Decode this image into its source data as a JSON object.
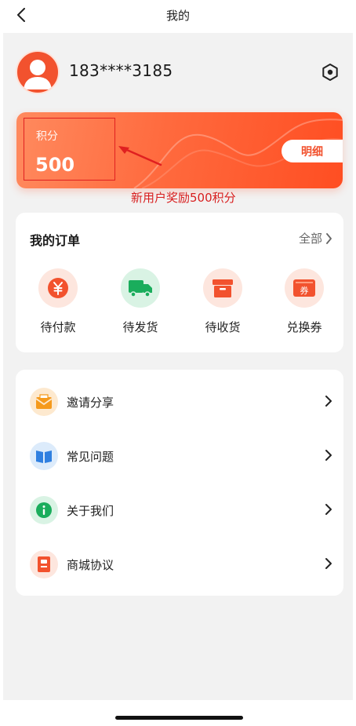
{
  "nav": {
    "title": "我的"
  },
  "profile": {
    "phone": "183****3185"
  },
  "points": {
    "label": "积分",
    "value": "500",
    "detail_label": "明细"
  },
  "annotation": {
    "text": "新用户奖励500积分",
    "color": "#d81e1e"
  },
  "orders": {
    "title": "我的订单",
    "all_label": "全部",
    "items": [
      {
        "label": "待付款",
        "icon": "yen-icon"
      },
      {
        "label": "待发货",
        "icon": "truck-icon"
      },
      {
        "label": "待收货",
        "icon": "box-icon"
      },
      {
        "label": "兑换券",
        "icon": "coupon-icon"
      }
    ]
  },
  "menu": {
    "items": [
      {
        "label": "邀请分享",
        "icon": "envelope-icon"
      },
      {
        "label": "常见问题",
        "icon": "book-icon"
      },
      {
        "label": "关于我们",
        "icon": "info-icon"
      },
      {
        "label": "商城协议",
        "icon": "document-icon"
      }
    ]
  },
  "colors": {
    "accent": "#f2522e",
    "card_gradient_start": "#ff8a5e",
    "card_gradient_end": "#ff4e22",
    "background": "#f2f2f2"
  }
}
